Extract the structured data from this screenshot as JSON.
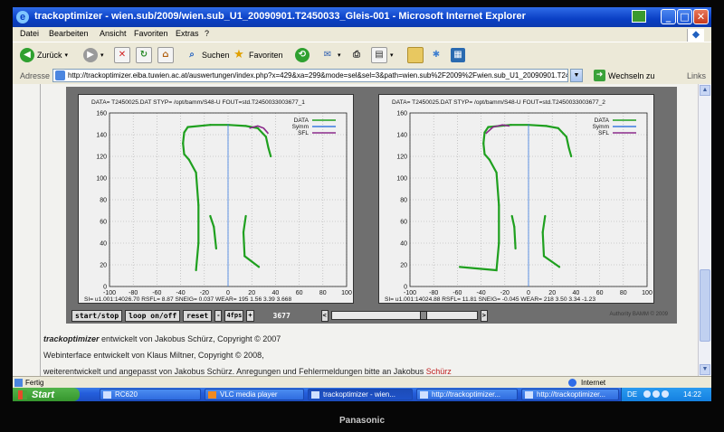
{
  "window": {
    "title": "trackoptimizer - wien.sub/2009/wien.sub_U1_20090901.T2450033_Gleis-001 - Microsoft Internet Explorer",
    "buttons": {
      "minimize": "_",
      "maximize": "□",
      "close": "✕"
    }
  },
  "menu": [
    "Datei",
    "Bearbeiten",
    "Ansicht",
    "Favoriten",
    "Extras",
    "?"
  ],
  "toolbar": {
    "back": "Zurück",
    "search": "Suchen",
    "favorites": "Favoriten"
  },
  "address": {
    "label": "Adresse",
    "url": "http://trackoptimizer.eiba.tuwien.ac.at/auswertungen/index.php?x=429&xa=299&mode=sel&sel=3&path=wien.sub%2F2009%2Fwien.sub_U1_20090901.T2450",
    "go": "Wechseln zu",
    "links": "Links"
  },
  "plots": [
    {
      "header": "DATA= T2450025.DAT STYP= /opt/bamm/S48-U FOUT=std.T2450033003677_1",
      "footer": "SI=   u1.001:14026.70 RSFL= 8.87 SNEIG= 0.037 WEAR= 195 1.56 3.39 3.668"
    },
    {
      "header": "DATA= T2450025.DAT STYP= /opt/bamm/S48-U FOUT=std.T2450033003677_2",
      "footer": "SI=   u1.001:14024.88 RSFL= 11.81 SNEIG= -0.045 WEAR= 218 3.50 3.34 -1.23"
    }
  ],
  "chart_data": [
    {
      "type": "line",
      "xlim": [
        -100,
        100
      ],
      "ylim": [
        0,
        160
      ],
      "xticks": [
        -100,
        -80,
        -60,
        -40,
        -20,
        0,
        20,
        40,
        60,
        80,
        100
      ],
      "yticks": [
        0,
        20,
        40,
        60,
        80,
        100,
        120,
        140,
        160
      ],
      "grid": true,
      "legend": [
        "DATA",
        "Symm",
        "SFL"
      ],
      "legend_position": "top-right",
      "series": [
        {
          "name": "DATA",
          "points": [
            [
              -27,
              15
            ],
            [
              -25,
              40
            ],
            [
              -25,
              75
            ],
            [
              -27,
              105
            ],
            [
              -33,
              117
            ],
            [
              -37,
              122
            ],
            [
              -38,
              132
            ],
            [
              -37,
              142
            ],
            [
              -34,
              147
            ],
            [
              -15,
              149
            ],
            [
              0,
              149
            ],
            [
              15,
              148
            ],
            [
              25,
              146
            ],
            [
              32,
              138
            ],
            [
              34,
              128
            ],
            [
              36,
              120
            ],
            [
              null,
              null
            ],
            [
              -15,
              65
            ],
            [
              -12,
              55
            ],
            [
              -10,
              35
            ],
            [
              null,
              null
            ],
            [
              15,
              65
            ],
            [
              13,
              50
            ],
            [
              14,
              28
            ],
            [
              26,
              18
            ]
          ]
        },
        {
          "name": "Symm",
          "points": [
            [
              0,
              0
            ],
            [
              0,
              150
            ]
          ]
        },
        {
          "name": "SFL",
          "points": [
            [
              18,
              146
            ],
            [
              25,
              148
            ],
            [
              30,
              146
            ],
            [
              34,
              141
            ]
          ]
        }
      ]
    },
    {
      "type": "line",
      "xlim": [
        -100,
        100
      ],
      "ylim": [
        0,
        160
      ],
      "xticks": [
        -100,
        -80,
        -60,
        -40,
        -20,
        0,
        20,
        40,
        60,
        80,
        100
      ],
      "yticks": [
        0,
        20,
        40,
        60,
        80,
        100,
        120,
        140,
        160
      ],
      "grid": true,
      "legend": [
        "DATA",
        "Symm",
        "SFL"
      ],
      "legend_position": "top-right",
      "series": [
        {
          "name": "DATA",
          "points": [
            [
              -58,
              18
            ],
            [
              -27,
              15
            ],
            [
              -25,
              40
            ],
            [
              -25,
              75
            ],
            [
              -27,
              105
            ],
            [
              -33,
              117
            ],
            [
              -37,
              122
            ],
            [
              -38,
              132
            ],
            [
              -37,
              142
            ],
            [
              -34,
              147
            ],
            [
              -15,
              149
            ],
            [
              0,
              149
            ],
            [
              15,
              148
            ],
            [
              25,
              146
            ],
            [
              32,
              138
            ],
            [
              34,
              128
            ],
            [
              36,
              120
            ],
            [
              null,
              null
            ],
            [
              -14,
              65
            ],
            [
              -12,
              55
            ],
            [
              -11,
              35
            ],
            [
              null,
              null
            ],
            [
              14,
              65
            ],
            [
              12,
              50
            ],
            [
              13,
              28
            ],
            [
              26,
              18
            ]
          ]
        },
        {
          "name": "Symm",
          "points": [
            [
              0,
              0
            ],
            [
              0,
              150
            ]
          ]
        },
        {
          "name": "SFL",
          "points": [
            [
              -36,
              141
            ],
            [
              -30,
              147
            ],
            [
              -22,
              149
            ],
            [
              -16,
              148
            ]
          ]
        }
      ]
    }
  ],
  "controls": {
    "start_stop": "start/stop",
    "loop": "loop on/off",
    "reset": "reset",
    "fps": "4fps",
    "minus": "-",
    "plus": "+",
    "frame": "3677",
    "slider_left": "<",
    "slider_right": ">",
    "slider_position": 0.63
  },
  "plot_credit": "Authority BAMM © 2009",
  "footer": {
    "line1_brand": "trackoptimizer",
    "line1_rest": " entwickelt von Jakobus Schürz, Copyright © 2007",
    "line2": "Webinterface entwickelt von Klaus Miltner, Copyright © 2008,",
    "line3_a": "weiterentwickelt und angepasst von Jakobus Schürz. Anregungen und Fehlermeldungen bitte an Jakobus ",
    "line3_link": "Schürz"
  },
  "status": {
    "text": "Fertig",
    "zone": "Internet"
  },
  "taskbar": {
    "start": "Start",
    "tasks": [
      "RC620",
      "VLC media player",
      "trackoptimizer - wien...",
      "http://trackoptimizer...",
      "http://trackoptimizer..."
    ],
    "lang": "DE",
    "clock": "14:22"
  },
  "monitor_brand": "Panasonic",
  "colors": {
    "data": "#1fa01f",
    "symm": "#3a7be0",
    "sfl": "#8a2a8a",
    "titlebar": "#0a3fc4"
  }
}
